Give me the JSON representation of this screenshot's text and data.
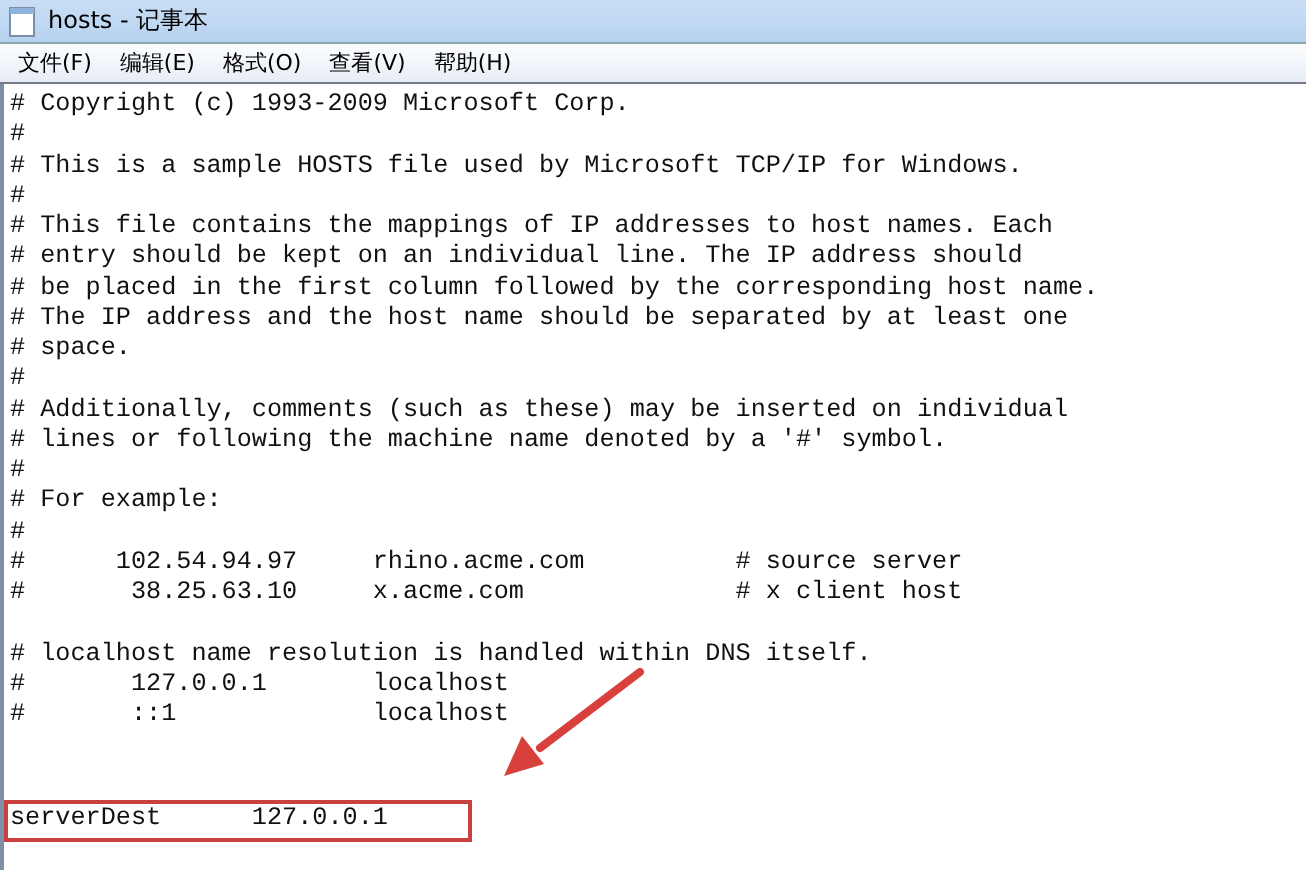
{
  "window": {
    "title": "hosts - 记事本"
  },
  "menu": [
    "文件(F)",
    "编辑(E)",
    "格式(O)",
    "查看(V)",
    "帮助(H)"
  ],
  "editor": {
    "lines": [
      {
        "kind": "text",
        "text": "# Copyright (c) 1993-2009 Microsoft Corp."
      },
      {
        "kind": "text",
        "text": "#"
      },
      {
        "kind": "text",
        "text": "# This is a sample HOSTS file used by Microsoft TCP/IP for Windows."
      },
      {
        "kind": "text",
        "text": "#"
      },
      {
        "kind": "text",
        "text": "# This file contains the mappings of IP addresses to host names. Each"
      },
      {
        "kind": "text",
        "text": "# entry should be kept on an individual line. The IP address should"
      },
      {
        "kind": "text",
        "text": "# be placed in the first column followed by the corresponding host name."
      },
      {
        "kind": "text",
        "text": "# The IP address and the host name should be separated by at least one"
      },
      {
        "kind": "text",
        "text": "# space."
      },
      {
        "kind": "text",
        "text": "#"
      },
      {
        "kind": "text",
        "text": "# Additionally, comments (such as these) may be inserted on individual"
      },
      {
        "kind": "text",
        "text": "# lines or following the machine name denoted by a '#' symbol."
      },
      {
        "kind": "text",
        "text": "#"
      },
      {
        "kind": "text",
        "text": "# For example:"
      },
      {
        "kind": "text",
        "text": "#"
      },
      {
        "kind": "text",
        "text": "#      102.54.94.97     rhino.acme.com          # source server"
      },
      {
        "kind": "text",
        "text": "#       38.25.63.10     x.acme.com              # x client host"
      },
      {
        "kind": "blank"
      },
      {
        "kind": "text",
        "text": "# localhost name resolution is handled within DNS itself."
      },
      {
        "kind": "text",
        "text": "#       127.0.0.1       localhost"
      },
      {
        "kind": "text",
        "text": "#       ::1             localhost"
      },
      {
        "kind": "blank"
      },
      {
        "kind": "blank"
      },
      {
        "kind": "marked",
        "text": "serverDest      127.0.0.1"
      }
    ]
  }
}
